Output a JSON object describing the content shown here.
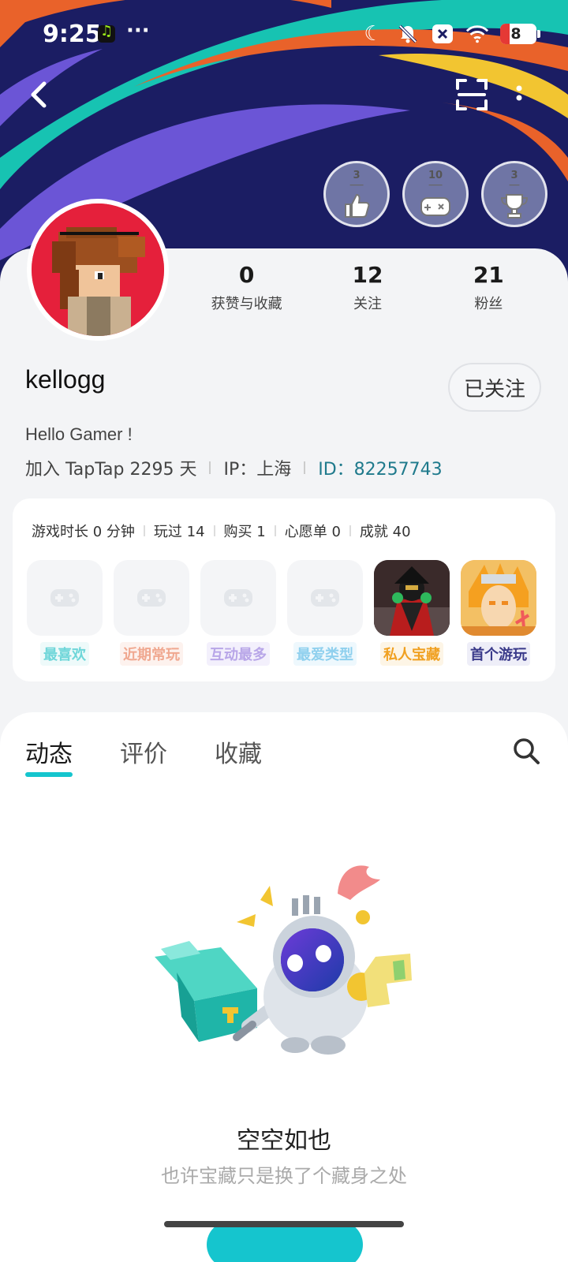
{
  "status_bar": {
    "time": "9:25",
    "overflow_dots": "···",
    "battery_level": "8"
  },
  "profile": {
    "username": "kellogg",
    "follow_label": "已关注",
    "bio": "Hello Gamer !",
    "joined": "加入 TapTap 2295 天",
    "ip": "IP：上海",
    "id": "ID：82257743"
  },
  "stats": [
    {
      "num": "0",
      "label": "获赞与收藏"
    },
    {
      "num": "12",
      "label": "关注"
    },
    {
      "num": "21",
      "label": "粉丝"
    }
  ],
  "badges": [
    {
      "num": "3",
      "icon": "thumbs-up-icon"
    },
    {
      "num": "10",
      "icon": "gamepad-icon"
    },
    {
      "num": "3",
      "icon": "trophy-icon"
    }
  ],
  "game_stats": [
    "游戏时长 0 分钟",
    "玩过 14",
    "购买 1",
    "心愿单 0",
    "成就 40"
  ],
  "shelf": [
    {
      "label": "最喜欢",
      "color": "#6fd6d9"
    },
    {
      "label": "近期常玩",
      "color": "#f0a890"
    },
    {
      "label": "互动最多",
      "color": "#b8a6e8"
    },
    {
      "label": "最爱类型",
      "color": "#8fd0ee"
    },
    {
      "label": "私人宝藏",
      "color": "#f0a020"
    },
    {
      "label": "首个游玩",
      "color": "#3a3a8a"
    }
  ],
  "tabs": [
    "动态",
    "评价",
    "收藏"
  ],
  "empty": {
    "title": "空空如也",
    "subtitle": "也许宝藏只是换了个藏身之处"
  },
  "colors": {
    "accent": "#15c5ce",
    "header_bg": "#1b1d63"
  }
}
